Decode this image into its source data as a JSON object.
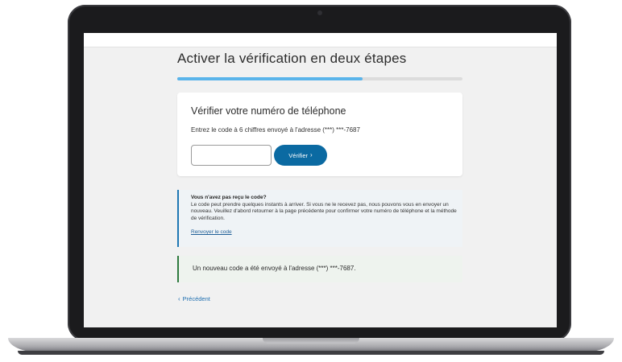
{
  "page": {
    "title": "Activer la vérification en deux étapes",
    "progress": 0.65
  },
  "card": {
    "title": "Vérifier votre numéro de téléphone",
    "instruction": "Entrez le code à 6 chiffres envoyé à l'adresse (***) ***-7687",
    "input_value": "",
    "verify_label": "Vérifier",
    "verify_icon": "chevron-right-icon"
  },
  "info": {
    "title": "Vous n'avez pas reçu le code?",
    "body": "Le code peut prendre quelques instants à arriver. Si vous ne le recevez pas, nous pouvons vous en envoyer un nouveau. Veuillez d'abord retourner à la page précédente pour confirmer votre numéro de téléphone et la méthode de vérification.",
    "resend_label": "Renvoyer le code"
  },
  "success": {
    "message": "Un nouveau code a été envoyé à l'adresse (***) ***-7687."
  },
  "nav": {
    "back_label": "Précédent",
    "back_icon": "chevron-left-icon"
  },
  "colors": {
    "accent": "#0b6aa2",
    "progress": "#5ab4ea",
    "info_border": "#1f78b4",
    "success_border": "#2f7a3f"
  }
}
